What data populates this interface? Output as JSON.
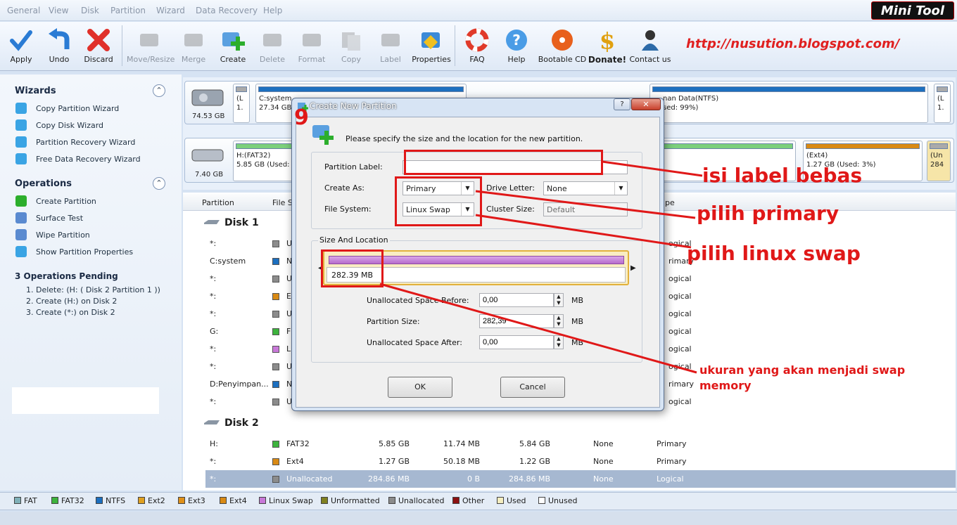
{
  "menu": [
    "General",
    "View",
    "Disk",
    "Partition",
    "Wizard",
    "Data Recovery",
    "Help"
  ],
  "logo": {
    "part1": "Mini",
    "part2": "Tool"
  },
  "toolbar": {
    "apply": "Apply",
    "undo": "Undo",
    "discard": "Discard",
    "move": "Move/Resize",
    "merge": "Merge",
    "create": "Create",
    "delete": "Delete",
    "format": "Format",
    "copy": "Copy",
    "label": "Label",
    "properties": "Properties",
    "faq": "FAQ",
    "help": "Help",
    "bootable": "Bootable CD",
    "donate": "Donate!",
    "contact": "Contact us"
  },
  "blog_url": "http://nusution.blogspot.com/",
  "sidebar": {
    "wizards_title": "Wizards",
    "wizards": [
      "Copy Partition Wizard",
      "Copy Disk Wizard",
      "Partition Recovery Wizard",
      "Free Data Recovery Wizard"
    ],
    "operations_title": "Operations",
    "operations": [
      "Create Partition",
      "Surface Test",
      "Wipe Partition",
      "Show Partition Properties"
    ],
    "pending_title": "3 Operations Pending",
    "pending": [
      "1. Delete: (H: ( Disk 2 Partition 1 ))",
      "2. Create (H:) on Disk 2",
      "3. Create (*:) on Disk 2"
    ]
  },
  "diskmap": {
    "disk1_size": "74.53 GB",
    "disk1_p1a": "(L",
    "disk1_p1b": "1.",
    "disk1_csys": "C:system",
    "disk1_csize": "27.34 GB",
    "disk1_data": "nan Data(NTFS)",
    "disk1_used": "sed: 99%)",
    "disk1_last_a": "(L",
    "disk1_last_b": "1.",
    "disk2_size": "7.40 GB",
    "disk2_h": "H:(FAT32)",
    "disk2_hsize": "5.85 GB (Used:",
    "disk2_ext4": "(Ext4)",
    "disk2_ext4b": "1.27 GB (Used: 3%)",
    "disk2_un": "(Un",
    "disk2_un2": "284"
  },
  "table": {
    "headers": {
      "partition": "Partition",
      "fs": "File Sy",
      "type": "pe"
    },
    "disk1": "Disk 1",
    "disk1_rows": [
      {
        "p": "*:",
        "c": "#8c8c8c",
        "t": "U",
        "ty": "ogical"
      },
      {
        "p": "C:system",
        "c": "#1c6fbf",
        "t": "N",
        "ty": "rimary"
      },
      {
        "p": "*:",
        "c": "#8c8c8c",
        "t": "U",
        "ty": "ogical"
      },
      {
        "p": "*:",
        "c": "#d98a14",
        "t": "E",
        "ty": "ogical"
      },
      {
        "p": "*:",
        "c": "#8c8c8c",
        "t": "U",
        "ty": "ogical"
      },
      {
        "p": "G:",
        "c": "#3db33d",
        "t": "F",
        "ty": "ogical"
      },
      {
        "p": "*:",
        "c": "#c878d8",
        "t": "L",
        "ty": "ogical"
      },
      {
        "p": "*:",
        "c": "#8c8c8c",
        "t": "U",
        "ty": "ogical"
      },
      {
        "p": "D:Penyimpan...",
        "c": "#1c6fbf",
        "t": "N",
        "ty": "rimary"
      },
      {
        "p": "*:",
        "c": "#8c8c8c",
        "t": "U",
        "ty": "ogical"
      }
    ],
    "disk2": "Disk 2",
    "disk2_rows": [
      {
        "p": "H:",
        "c": "#3db33d",
        "fs": "FAT32",
        "cap": "5.85 GB",
        "used": "11.74 MB",
        "unused": "5.84 GB",
        "sys": "None",
        "ty": "Primary"
      },
      {
        "p": "*:",
        "c": "#d98a14",
        "fs": "Ext4",
        "cap": "1.27 GB",
        "used": "50.18 MB",
        "unused": "1.22 GB",
        "sys": "None",
        "ty": "Primary"
      },
      {
        "p": "*:",
        "c": "#8c8c8c",
        "fs": "Unallocated",
        "cap": "284.86 MB",
        "used": "0 B",
        "unused": "284.86 MB",
        "sys": "None",
        "ty": "Logical"
      }
    ]
  },
  "legend": [
    {
      "label": "FAT",
      "color": "#7fb0b8"
    },
    {
      "label": "FAT32",
      "color": "#3db33d"
    },
    {
      "label": "NTFS",
      "color": "#1c6fbf"
    },
    {
      "label": "Ext2",
      "color": "#e0a020"
    },
    {
      "label": "Ext3",
      "color": "#e09018"
    },
    {
      "label": "Ext4",
      "color": "#d98a14"
    },
    {
      "label": "Linux Swap",
      "color": "#c878d8"
    },
    {
      "label": "Unformatted",
      "color": "#808020"
    },
    {
      "label": "Unallocated",
      "color": "#8c8c8c"
    },
    {
      "label": "Other",
      "color": "#8b1010"
    },
    {
      "label": "Used",
      "color": "#f5eec0"
    },
    {
      "label": "Unused",
      "color": "#ffffff"
    }
  ],
  "dialog": {
    "title": "Create New Partition",
    "step": "9",
    "intro": "Please specify the size and the location for the new partition.",
    "partition_label": "Partition Label:",
    "partition_label_value": "",
    "create_as": "Create As:",
    "create_as_value": "Primary",
    "drive_letter": "Drive Letter:",
    "drive_letter_value": "None",
    "file_system": "File System:",
    "file_system_value": "Linux Swap",
    "cluster_size": "Cluster Size:",
    "cluster_size_value": "Default",
    "size_location": "Size And Location",
    "bar_size": "282.39 MB",
    "unalloc_before": "Unallocated Space Before:",
    "unalloc_before_value": "0,00",
    "partition_size": "Partition Size:",
    "partition_size_value": "282,39",
    "unalloc_after": "Unallocated Space After:",
    "unalloc_after_value": "0,00",
    "unit": "MB",
    "ok": "OK",
    "cancel": "Cancel",
    "help": "?"
  },
  "annotations": {
    "label": "isi label bebas",
    "primary": "pilih primary",
    "swap": "pilih linux swap",
    "size": "ukuran yang akan menjadi swap memory"
  }
}
